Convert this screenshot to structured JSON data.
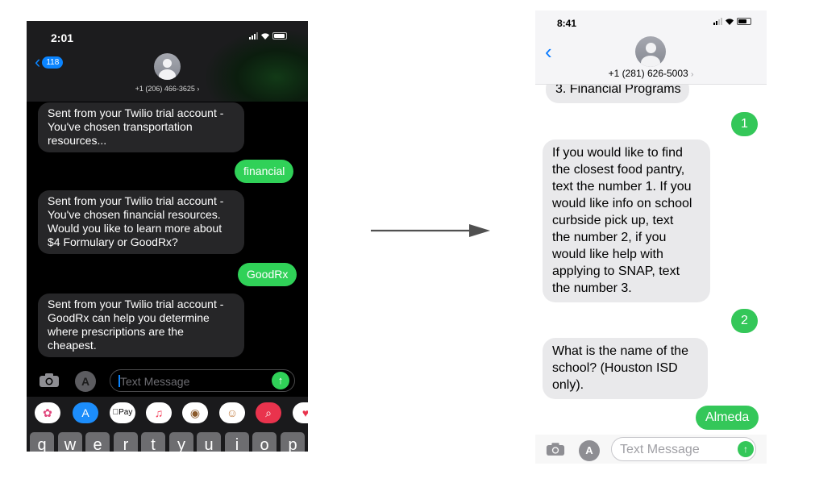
{
  "left_phone": {
    "status": {
      "time": "2:01"
    },
    "header": {
      "back_badge": "118",
      "contact": "+1 (206) 466-3625 ›"
    },
    "messages": [
      {
        "dir": "in",
        "text": "Sent from your Twilio trial account -\nYou've chosen transportation\nresources..."
      },
      {
        "dir": "out",
        "text": "financial"
      },
      {
        "dir": "in",
        "text": "Sent from your Twilio trial account -\nYou've chosen financial resources.\nWould you like to learn more about\n$4 Formulary or GoodRx?"
      },
      {
        "dir": "out",
        "text": "GoodRx"
      },
      {
        "dir": "in",
        "text": "Sent from your Twilio trial account -\nGoodRx can help you determine\nwhere prescriptions are the\ncheapest."
      }
    ],
    "input": {
      "placeholder": "Text Message"
    },
    "app_tray": [
      {
        "icon": "photos-icon"
      },
      {
        "icon": "app-store-icon"
      },
      {
        "icon": "apple-pay-icon",
        "label": "Pay"
      },
      {
        "icon": "music-icon"
      },
      {
        "icon": "monkey-memoji-icon"
      },
      {
        "icon": "memoji-icon"
      },
      {
        "icon": "image-search-icon"
      },
      {
        "icon": "heart-sticker-icon"
      }
    ],
    "keyboard_row": [
      "q",
      "w",
      "e",
      "r",
      "t",
      "y",
      "u",
      "i",
      "o",
      "p"
    ]
  },
  "right_phone": {
    "status": {
      "time": "8:41"
    },
    "header": {
      "contact": "+1 (281) 626-5003",
      "contact_chevron": "›"
    },
    "messages": [
      {
        "dir": "in",
        "text": "3. Financial Programs"
      },
      {
        "dir": "out",
        "text": "1"
      },
      {
        "dir": "in",
        "text": "If you would like to find\nthe closest food pantry,\ntext the number 1. If you\nwould like info on school\ncurbside pick up, text\nthe number 2, if you\nwould like help with\napplying to SNAP, text\nthe number 3."
      },
      {
        "dir": "out",
        "text": "2"
      },
      {
        "dir": "in",
        "text": "What is the name of the\nschool? (Houston ISD\nonly)."
      },
      {
        "dir": "out",
        "text": "Almeda"
      }
    ],
    "input": {
      "placeholder": "Text Message"
    }
  },
  "colors": {
    "imessage_blue": "#0a84ff",
    "sms_green": "#34c759",
    "dark_bubble": "#262628",
    "light_bubble": "#e9e9eb"
  }
}
